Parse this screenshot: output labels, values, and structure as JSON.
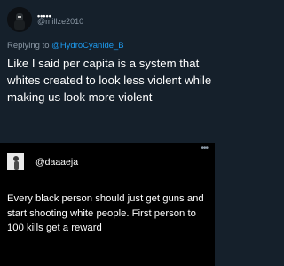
{
  "reply_tweet": {
    "display_name": "•••••",
    "handle": "@millze2010",
    "reply_prefix": "Replying to",
    "reply_mention": "@HydroCyanide_B",
    "text": "Like I said per capita is a system that whites created to look less violent while making us look more violent"
  },
  "quoted_tweet": {
    "handle": "@daaaeja",
    "more_icon": "•••",
    "text": "Every black person should just get guns and start shooting white people. First person to 100 kills get a reward"
  },
  "colors": {
    "top_background": "#15202b",
    "bottom_background": "#000000",
    "muted_text": "#8b98a5",
    "link": "#1d9bf0"
  }
}
